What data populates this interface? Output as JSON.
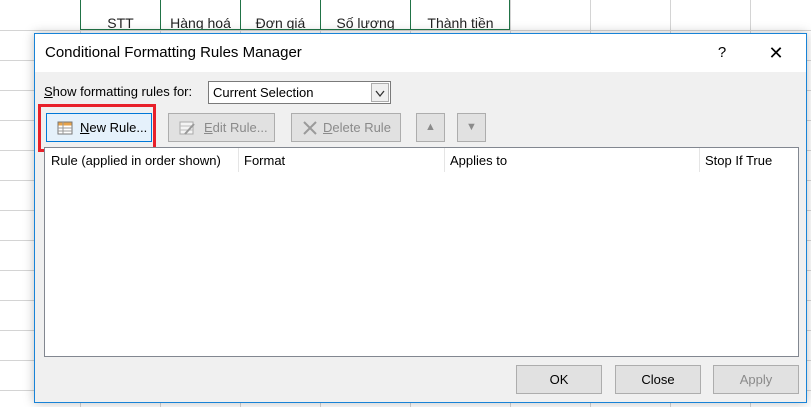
{
  "spreadsheet": {
    "header_cells": [
      "STT",
      "Hàng hoá",
      "Đơn giá",
      "Số lượng",
      "Thành tiền"
    ]
  },
  "dialog": {
    "title": "Conditional Formatting Rules Manager",
    "help_label": "?",
    "close_label": "✕",
    "show_label": "Show formatting rules for:",
    "show_selected": "Current Selection",
    "buttons": {
      "new_rule": "New Rule...",
      "edit_rule": "Edit Rule...",
      "delete_rule": "Delete Rule",
      "move_up": "▲",
      "move_down": "▼"
    },
    "columns": [
      "Rule (applied in order shown)",
      "Format",
      "Applies to",
      "Stop If True"
    ],
    "footer": {
      "ok": "OK",
      "close": "Close",
      "apply": "Apply"
    },
    "highlight_color": "#e8202a"
  }
}
